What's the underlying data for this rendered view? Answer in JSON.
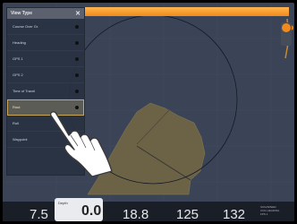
{
  "menu": {
    "title": "View Type",
    "items": [
      {
        "label": "Course Over Gr."
      },
      {
        "label": "Heading"
      },
      {
        "label": "GPS 1"
      },
      {
        "label": "GPS 2"
      },
      {
        "label": "Time of Travel"
      },
      {
        "label": "Rout",
        "selected": true
      },
      {
        "label": "Roll"
      },
      {
        "label": "Waypoint"
      }
    ]
  },
  "databar": {
    "values": [
      "7.5",
      "18.8",
      "125",
      "132"
    ],
    "highlight_label": "Depth",
    "highlight_value": "0.0",
    "units": [
      "SOG/SPEED",
      "COG HEADING",
      "FPS 1"
    ]
  },
  "colors": {
    "accent": "#f08a1c",
    "water": "#3a4355",
    "land": "#6f6546",
    "selection": "#c9a75a"
  },
  "icons": {
    "close": "close-icon",
    "compass": "compass-icon",
    "pointer": "hand-pointer-icon"
  }
}
